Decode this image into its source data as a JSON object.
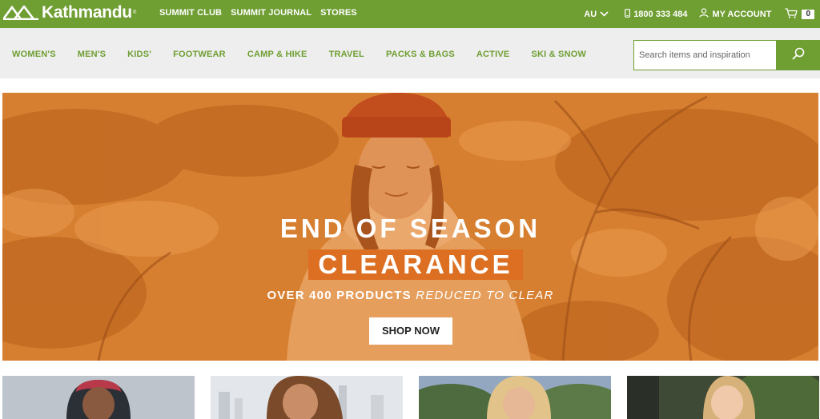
{
  "brand": {
    "name": "Kathmandu",
    "reg_mark": "®"
  },
  "top_links": [
    "SUMMIT CLUB",
    "SUMMIT JOURNAL",
    "STORES"
  ],
  "top_right": {
    "region": "AU",
    "phone": "1800 333 484",
    "account": "MY ACCOUNT",
    "cart_count": "0"
  },
  "nav": {
    "items": [
      "WOMEN'S",
      "MEN'S",
      "KIDS'",
      "FOOTWEAR",
      "CAMP & HIKE",
      "TRAVEL",
      "PACKS & BAGS",
      "ACTIVE",
      "SKI & SNOW"
    ]
  },
  "search": {
    "placeholder": "Search items and inspiration",
    "value": ""
  },
  "hero": {
    "line1": "END OF SEASON",
    "line2": "CLEARANCE",
    "line3_bold": "OVER 400 PRODUCTS",
    "line3_italic": "REDUCED TO CLEAR",
    "cta": "SHOP NOW"
  },
  "icons": {
    "logo": "mountain-logo-icon",
    "region_chevron": "chevron-down-icon",
    "phone": "phone-icon",
    "account": "user-icon",
    "cart": "cart-icon",
    "search": "search-icon"
  },
  "colors": {
    "brand_green": "#6f9e32",
    "hero_orange": "#d9802f",
    "highlight_orange": "#dd6f23",
    "nav_bg": "#eeeeee"
  }
}
